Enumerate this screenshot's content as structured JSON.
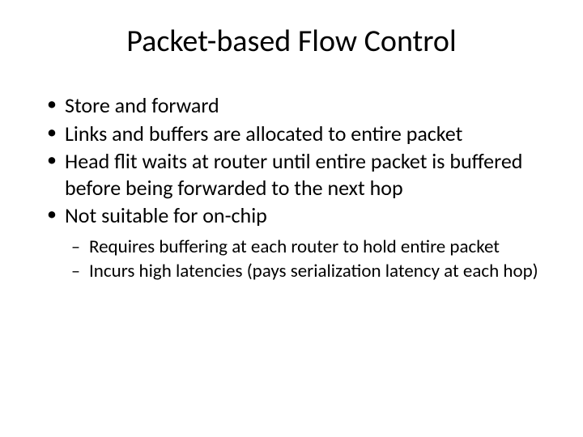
{
  "slide": {
    "title": "Packet-based Flow Control",
    "bullets": [
      "Store and forward",
      "Links and buffers are allocated to entire packet",
      "Head flit waits at router until entire packet is buffered before being forwarded to the next hop",
      "Not suitable for on-chip"
    ],
    "subbullets": [
      "Requires buffering at each router to hold entire packet",
      "Incurs high latencies (pays serialization latency at each hop)"
    ]
  }
}
